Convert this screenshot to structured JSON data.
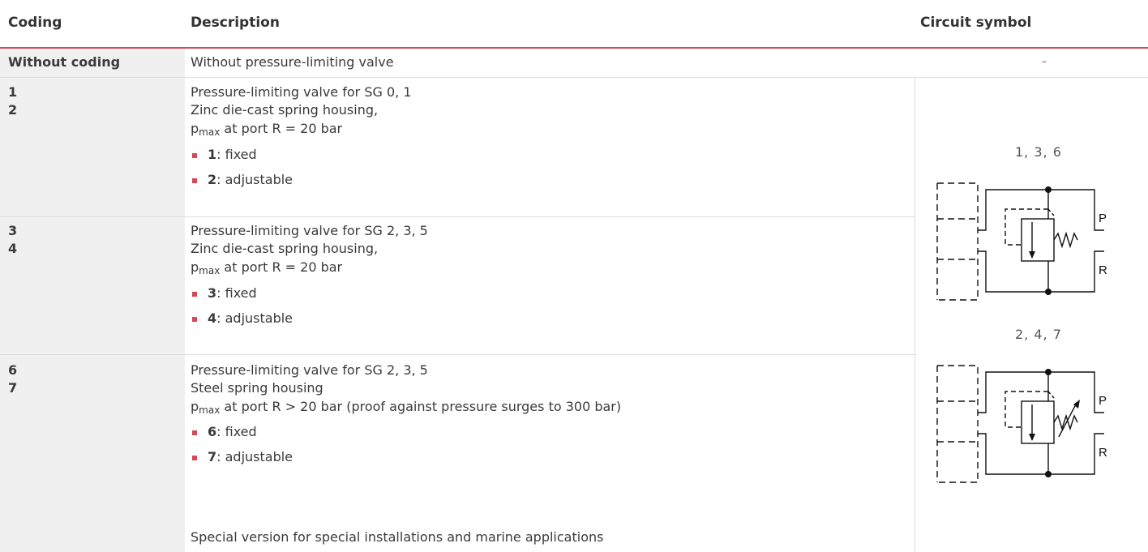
{
  "headers": {
    "coding": "Coding",
    "description": "Description",
    "circuit_symbol": "Circuit symbol"
  },
  "rows": [
    {
      "coding": [
        "Without coding"
      ],
      "description": [
        "Without pressure-limiting valve"
      ],
      "circuit_symbol": "-"
    },
    {
      "coding": [
        "1",
        "2"
      ],
      "description_line1": "Pressure-limiting valve for SG 0, 1",
      "description_line2": "Zinc die-cast spring housing,",
      "pmax_p": "p",
      "pmax_sub": "max",
      "pmax_rest": " at port R = 20 bar",
      "options": [
        {
          "code": "1",
          "text": ": fixed"
        },
        {
          "code": "2",
          "text": ": adjustable"
        }
      ]
    },
    {
      "coding": [
        "3",
        "4"
      ],
      "description_line1": "Pressure-limiting valve for SG 2, 3, 5",
      "description_line2": "Zinc die-cast spring housing,",
      "pmax_p": "p",
      "pmax_sub": "max",
      "pmax_rest": " at port R = 20 bar",
      "options": [
        {
          "code": "3",
          "text": ": fixed"
        },
        {
          "code": "4",
          "text": ": adjustable"
        }
      ]
    },
    {
      "coding": [
        "6",
        "7"
      ],
      "description_line1": "Pressure-limiting valve for SG 2, 3, 5",
      "description_line2": "Steel spring housing",
      "pmax_p": "p",
      "pmax_sub": "max",
      "pmax_rest": " at port R > 20 bar (proof against pressure surges to 300 bar)",
      "options": [
        {
          "code": "6",
          "text": ": fixed"
        },
        {
          "code": "7",
          "text": ": adjustable"
        }
      ],
      "note": "Special version for special installations and marine applications"
    }
  ],
  "symbols": [
    {
      "label": "1, 3, 6",
      "port_p": "P",
      "port_r": "R",
      "adjustable": false
    },
    {
      "label": "2, 4, 7",
      "port_p": "P",
      "port_r": "R",
      "adjustable": true
    }
  ]
}
